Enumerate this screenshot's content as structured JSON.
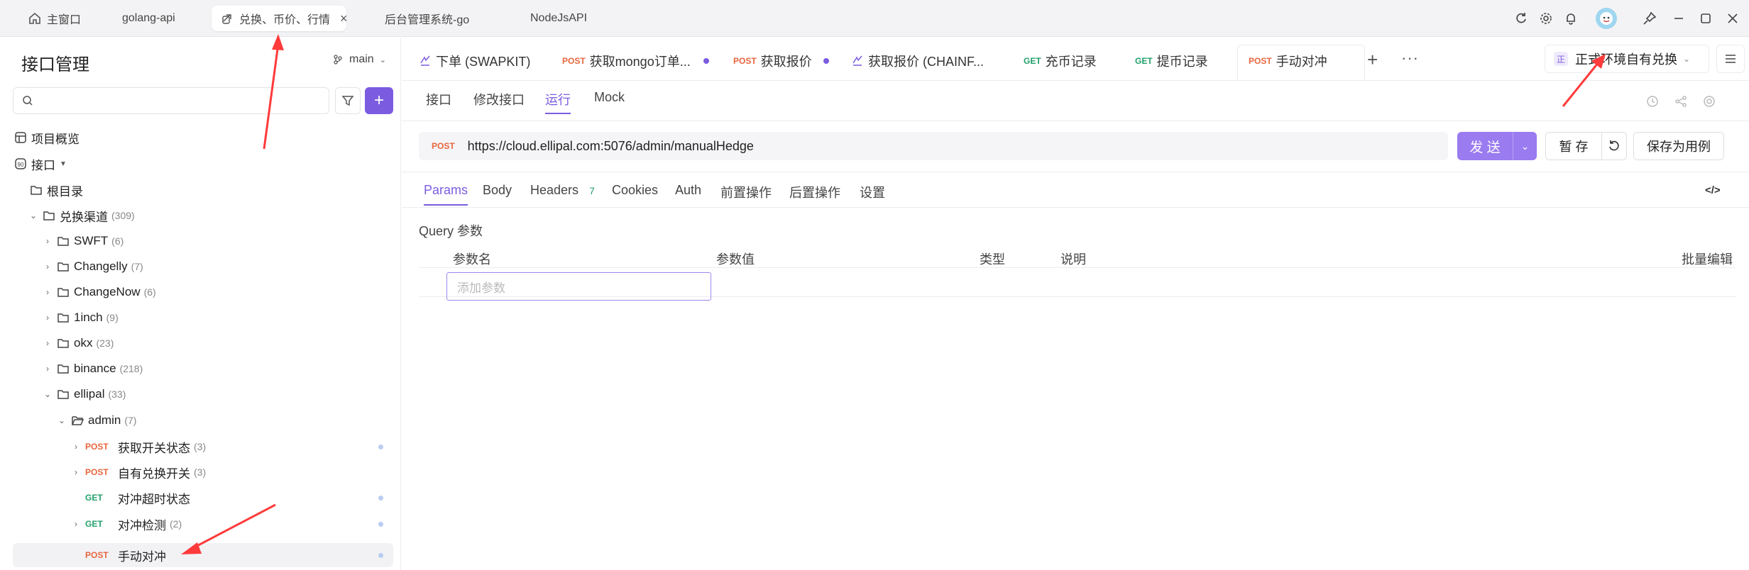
{
  "window_tabs": [
    {
      "label": "主窗口",
      "icon": "home-icon"
    },
    {
      "label": "golang-api"
    },
    {
      "label": "兑换、币价、行情",
      "icon": "link-icon",
      "active": true
    },
    {
      "label": "后台管理系统-go"
    },
    {
      "label": "NodeJsAPI"
    }
  ],
  "sidebar": {
    "title": "接口管理",
    "branch": "main",
    "search_placeholder": "",
    "overview_label": "项目概览",
    "interfaces_label": "接口",
    "root_label": "根目录",
    "tree": [
      {
        "label": "兑换渠道",
        "count": "(309)"
      },
      {
        "label": "SWFT",
        "count": "(6)"
      },
      {
        "label": "Changelly",
        "count": "(7)"
      },
      {
        "label": "ChangeNow",
        "count": "(6)"
      },
      {
        "label": "1inch",
        "count": "(9)"
      },
      {
        "label": "okx",
        "count": "(23)"
      },
      {
        "label": "binance",
        "count": "(218)"
      },
      {
        "label": "ellipal",
        "count": "(33)"
      },
      {
        "label": "admin",
        "count": "(7)"
      }
    ],
    "endpoints": [
      {
        "method": "POST",
        "label": "获取开关状态",
        "count": "(3)"
      },
      {
        "method": "POST",
        "label": "自有兑换开关",
        "count": "(3)"
      },
      {
        "method": "GET",
        "label": "对冲超时状态",
        "count": ""
      },
      {
        "method": "GET",
        "label": "对冲检测",
        "count": "(2)"
      },
      {
        "method": "POST",
        "label": "手动对冲",
        "count": ""
      }
    ]
  },
  "request_tabs": [
    {
      "method": "",
      "label": "下单 (SWAPKIT)"
    },
    {
      "method": "POST",
      "label": "获取mongo订单..."
    },
    {
      "method": "POST",
      "label": "获取报价"
    },
    {
      "method": "",
      "label": "获取报价 (CHAINF..."
    },
    {
      "method": "GET",
      "label": "充币记录"
    },
    {
      "method": "GET",
      "label": "提币记录"
    },
    {
      "method": "POST",
      "label": "手动对冲"
    }
  ],
  "environment": {
    "badge": "正",
    "label": "正式环境自有兑换"
  },
  "sub_tabs": [
    "接口",
    "修改接口",
    "运行",
    "Mock"
  ],
  "request": {
    "method": "POST",
    "url": "https://cloud.ellipal.com:5076/admin/manualHedge",
    "send_label": "发 送",
    "stash_label": "暂 存",
    "save_case_label": "保存为用例"
  },
  "param_tabs": [
    "Params",
    "Body",
    "Headers",
    "Cookies",
    "Auth",
    "前置操作",
    "后置操作",
    "设置"
  ],
  "headers_count": "7",
  "query": {
    "title": "Query 参数",
    "columns": [
      "参数名",
      "参数值",
      "类型",
      "说明"
    ],
    "bulk_edit": "批量编辑",
    "add_placeholder": "添加参数"
  },
  "colors": {
    "accent": "#7b5ce0",
    "post": "#e8663d",
    "get": "#22a06b",
    "arrow": "#ff3b3b"
  }
}
